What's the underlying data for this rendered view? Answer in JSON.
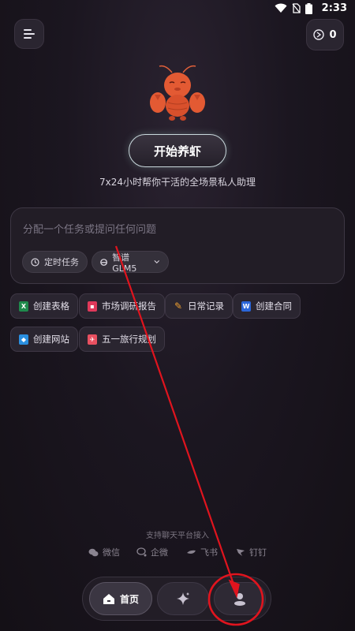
{
  "status_bar": {
    "time": "2:33"
  },
  "header": {
    "coin_count": "0"
  },
  "hero": {
    "start_button_label": "开始养虾",
    "tagline": "7x24小时帮你干活的全场景私人助理"
  },
  "input": {
    "placeholder": "分配一个任务或提问任何问题",
    "schedule_chip": "定时任务",
    "model_chip": "智谱 GLM5"
  },
  "quick_actions": [
    {
      "label": "创建表格",
      "icon": "excel-icon",
      "color": "#1f8a4c",
      "glyph": "X"
    },
    {
      "label": "市场调研报告",
      "icon": "report-icon",
      "color": "#e0395a",
      "glyph": ""
    },
    {
      "label": "日常记录",
      "icon": "pencil-icon",
      "color": "#f0a030",
      "glyph": ""
    },
    {
      "label": "创建合同",
      "icon": "word-icon",
      "color": "#2b66d9",
      "glyph": "W"
    },
    {
      "label": "创建网站",
      "icon": "website-icon",
      "color": "#2a8fe0",
      "glyph": ""
    },
    {
      "label": "五一旅行规划",
      "icon": "travel-icon",
      "color": "#e85060",
      "glyph": ""
    }
  ],
  "platforms": {
    "title": "支持聊天平台接入",
    "items": [
      {
        "label": "微信",
        "icon": "wechat-icon"
      },
      {
        "label": "企微",
        "icon": "wecom-icon"
      },
      {
        "label": "飞书",
        "icon": "feishu-icon"
      },
      {
        "label": "钉钉",
        "icon": "dingtalk-icon"
      }
    ]
  },
  "bottom_nav": {
    "home_label": "首页",
    "items": [
      "home-icon",
      "sparkle-icon",
      "profile-icon"
    ]
  },
  "colors": {
    "background": "#1b1620",
    "annotation_red": "#e0141e"
  }
}
